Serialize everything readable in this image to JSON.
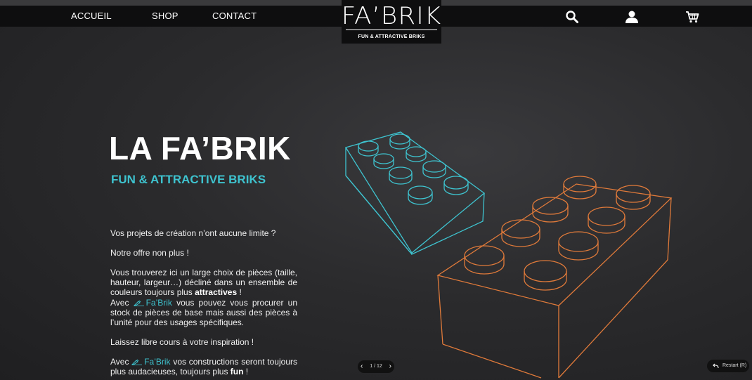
{
  "nav": {
    "links": [
      "ACCUEIL",
      "SHOP",
      "CONTACT"
    ],
    "logo": "FA’BRIK",
    "logo_tagline": "FUN & ATTRACTIVE BRIKS",
    "icons": [
      "search-icon",
      "user-icon",
      "cart-icon"
    ]
  },
  "hero": {
    "title": "LA FA’BRIK",
    "subtitle": "FUN & ATTRACTIVE BRIKS",
    "p1": "Vos projets de création n’ont aucune limite ?",
    "p2": "Notre offre non plus !",
    "p3_a": "Vous trouverez ici un large choix de pièces (taille, hauteur, largeur…) décliné dans un ensemble de couleurs toujours plus ",
    "p3_b": "attractives",
    "p3_c": " !",
    "p3_d": "Avec ",
    "brand": "Fa’Brik",
    "p3_e": " vous pouvez vous procurer un stock de pièces de base mais aussi des pièces à l’unité pour des usages spécifiques.",
    "p4": "Laissez libre cours à votre inspiration !",
    "p5_a": "Avec ",
    "p5_b": " vos constructions seront toujours plus audacieuses, toujours plus ",
    "p5_c": "fun",
    "p5_d": " !"
  },
  "slider": {
    "counter": "1 / 12",
    "prev": "‹",
    "next": "›"
  },
  "restart": {
    "label": "Restart (R)"
  },
  "colors": {
    "accent": "#3ec3cf",
    "orange": "#e07a3a",
    "navbar": "#0e0e0f"
  }
}
